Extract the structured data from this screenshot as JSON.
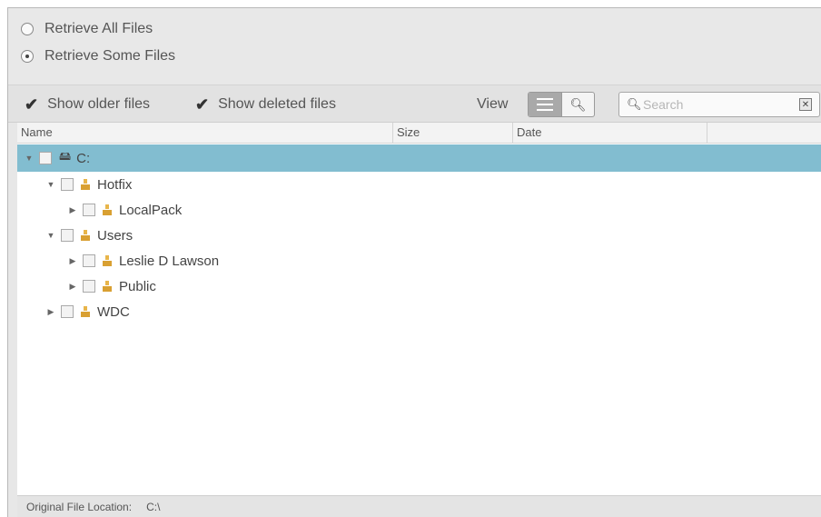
{
  "retrieve": {
    "all_label": "Retrieve All Files",
    "some_label": "Retrieve Some Files",
    "selected": "some"
  },
  "toolbar": {
    "show_older_label": "Show older files",
    "show_older_checked": true,
    "show_deleted_label": "Show deleted files",
    "show_deleted_checked": true,
    "view_label": "View",
    "search_placeholder": "Search"
  },
  "columns": [
    "Name",
    "Size",
    "Date"
  ],
  "tree": [
    {
      "label": "C:",
      "level": 0,
      "expanded": true,
      "type": "drive",
      "selected": true
    },
    {
      "label": "Hotfix",
      "level": 1,
      "expanded": true,
      "type": "folder"
    },
    {
      "label": "LocalPack",
      "level": 2,
      "expanded": false,
      "type": "folder"
    },
    {
      "label": "Users",
      "level": 1,
      "expanded": true,
      "type": "folder"
    },
    {
      "label": "Leslie D Lawson",
      "level": 2,
      "expanded": false,
      "type": "user-folder"
    },
    {
      "label": "Public",
      "level": 2,
      "expanded": false,
      "type": "folder"
    },
    {
      "label": "WDC",
      "level": 1,
      "expanded": false,
      "type": "folder"
    }
  ],
  "status": {
    "label": "Original File Location:",
    "value": "C:\\"
  },
  "colors": {
    "selected_row": "#82bdd0",
    "folder": "#e0ac3c"
  },
  "icons": {
    "radio_unchecked": "radio-unchecked-icon",
    "radio_checked": "radio-checked-icon",
    "checkmark": "checkmark-icon",
    "list_view": "list-view-icon",
    "search": "search-icon",
    "clear": "clear-icon",
    "folder": "folder-icon",
    "drive": "drive-icon",
    "expand": "caret-down-icon",
    "collapse": "caret-right-icon"
  }
}
